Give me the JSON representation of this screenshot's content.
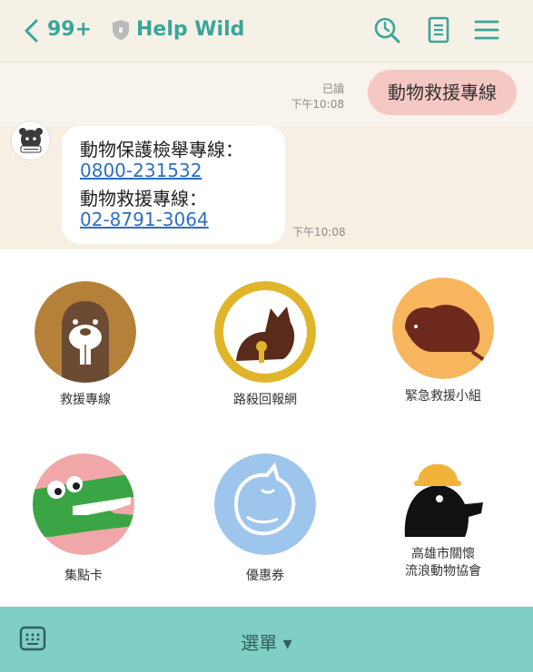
{
  "header": {
    "back_count": "99+",
    "title": "Help Wild",
    "icons": [
      "chevron-left-icon",
      "shield-icon",
      "search-clock-icon",
      "note-icon",
      "menu-icon"
    ],
    "accent_color": "#3aa59a"
  },
  "chat": {
    "outgoing": {
      "text": "動物救援專線",
      "read_label": "已讀",
      "time": "下午10:08"
    },
    "incoming": {
      "line1": "動物保護檢舉專線：",
      "link1": "0800-231532",
      "line2": "動物救援專線：",
      "link2": "02-8791-3064",
      "time": "下午10:08"
    }
  },
  "rich_menu": {
    "items": [
      {
        "label": "救援專線",
        "icon": "beaver-icon"
      },
      {
        "label": "路殺回報網",
        "icon": "cat-icon"
      },
      {
        "label": "緊急救援小組",
        "icon": "rat-icon"
      },
      {
        "label": "集點卡",
        "icon": "crocodile-icon"
      },
      {
        "label": "優惠券",
        "icon": "sleeping-cat-icon"
      },
      {
        "label": "高雄市關懷\n流浪動物協會",
        "icon": "mole-icon"
      }
    ]
  },
  "footer": {
    "menu_label": "選單 ▾",
    "keyboard_icon": "keyboard-icon"
  }
}
